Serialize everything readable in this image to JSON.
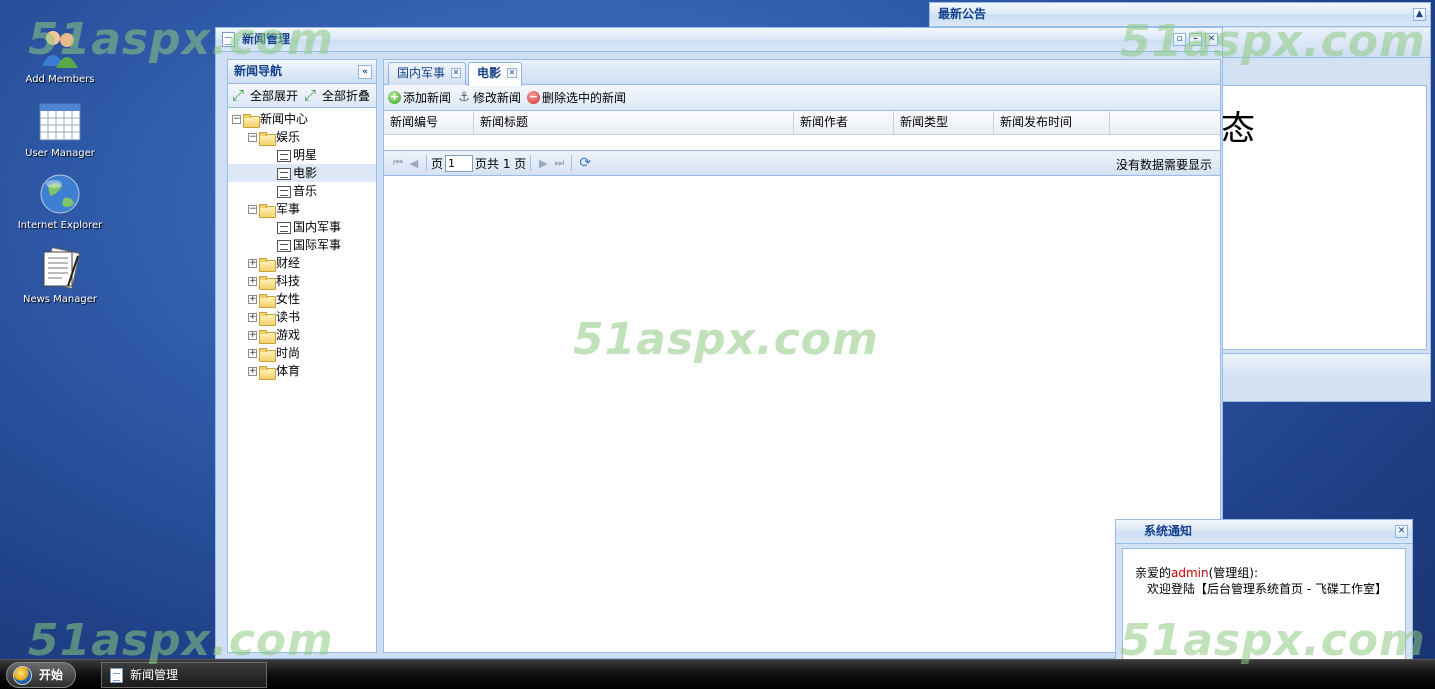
{
  "watermark": "51aspx.com",
  "desktop_icons": [
    {
      "label": "Add Members",
      "icon": "users-icon"
    },
    {
      "label": "User Manager",
      "icon": "calendar-grid-icon"
    },
    {
      "label": "Internet Explorer",
      "icon": "globe-icon"
    },
    {
      "label": "News Manager",
      "icon": "newspaper-icon"
    }
  ],
  "notice_window": {
    "title": "最新公告",
    "content_char": "态"
  },
  "main_window": {
    "title": "新闻管理"
  },
  "nav": {
    "title": "新闻导航",
    "expand_all": "全部展开",
    "collapse_all": "全部折叠",
    "tree": [
      {
        "label": "新闻中心",
        "level": 0,
        "type": "folder",
        "toggle": "−"
      },
      {
        "label": "娱乐",
        "level": 1,
        "type": "folder",
        "toggle": "−"
      },
      {
        "label": "明星",
        "level": 2,
        "type": "leaf"
      },
      {
        "label": "电影",
        "level": 2,
        "type": "leaf",
        "selected": true
      },
      {
        "label": "音乐",
        "level": 2,
        "type": "leaf"
      },
      {
        "label": "军事",
        "level": 1,
        "type": "folder",
        "toggle": "−"
      },
      {
        "label": "国内军事",
        "level": 2,
        "type": "leaf"
      },
      {
        "label": "国际军事",
        "level": 2,
        "type": "leaf"
      },
      {
        "label": "财经",
        "level": 1,
        "type": "folder",
        "toggle": "+"
      },
      {
        "label": "科技",
        "level": 1,
        "type": "folder",
        "toggle": "+"
      },
      {
        "label": "女性",
        "level": 1,
        "type": "folder",
        "toggle": "+"
      },
      {
        "label": "读书",
        "level": 1,
        "type": "folder",
        "toggle": "+"
      },
      {
        "label": "游戏",
        "level": 1,
        "type": "folder",
        "toggle": "+"
      },
      {
        "label": "时尚",
        "level": 1,
        "type": "folder",
        "toggle": "+"
      },
      {
        "label": "体育",
        "level": 1,
        "type": "folder",
        "toggle": "+"
      }
    ]
  },
  "tabs": [
    {
      "label": "国内军事",
      "active": false
    },
    {
      "label": "电影",
      "active": true
    }
  ],
  "toolbar": {
    "add": "添加新闻",
    "edit": "修改新闻",
    "delete": "删除选中的新闻"
  },
  "grid": {
    "columns": [
      "新闻编号",
      "新闻标题",
      "新闻作者",
      "新闻类型",
      "新闻发布时间"
    ]
  },
  "pager": {
    "page_label": "页",
    "page_value": "1",
    "total": "页共 1 页",
    "status": "没有数据需要显示"
  },
  "sys_notice": {
    "title": "系统通知",
    "greeting_prefix": "亲爱的",
    "user": "admin",
    "greeting_suffix": "(管理组):",
    "message": "欢迎登陆【后台管理系统首页 - 飞碟工作室】"
  },
  "taskbar": {
    "start": "开始",
    "item": "新闻管理"
  }
}
